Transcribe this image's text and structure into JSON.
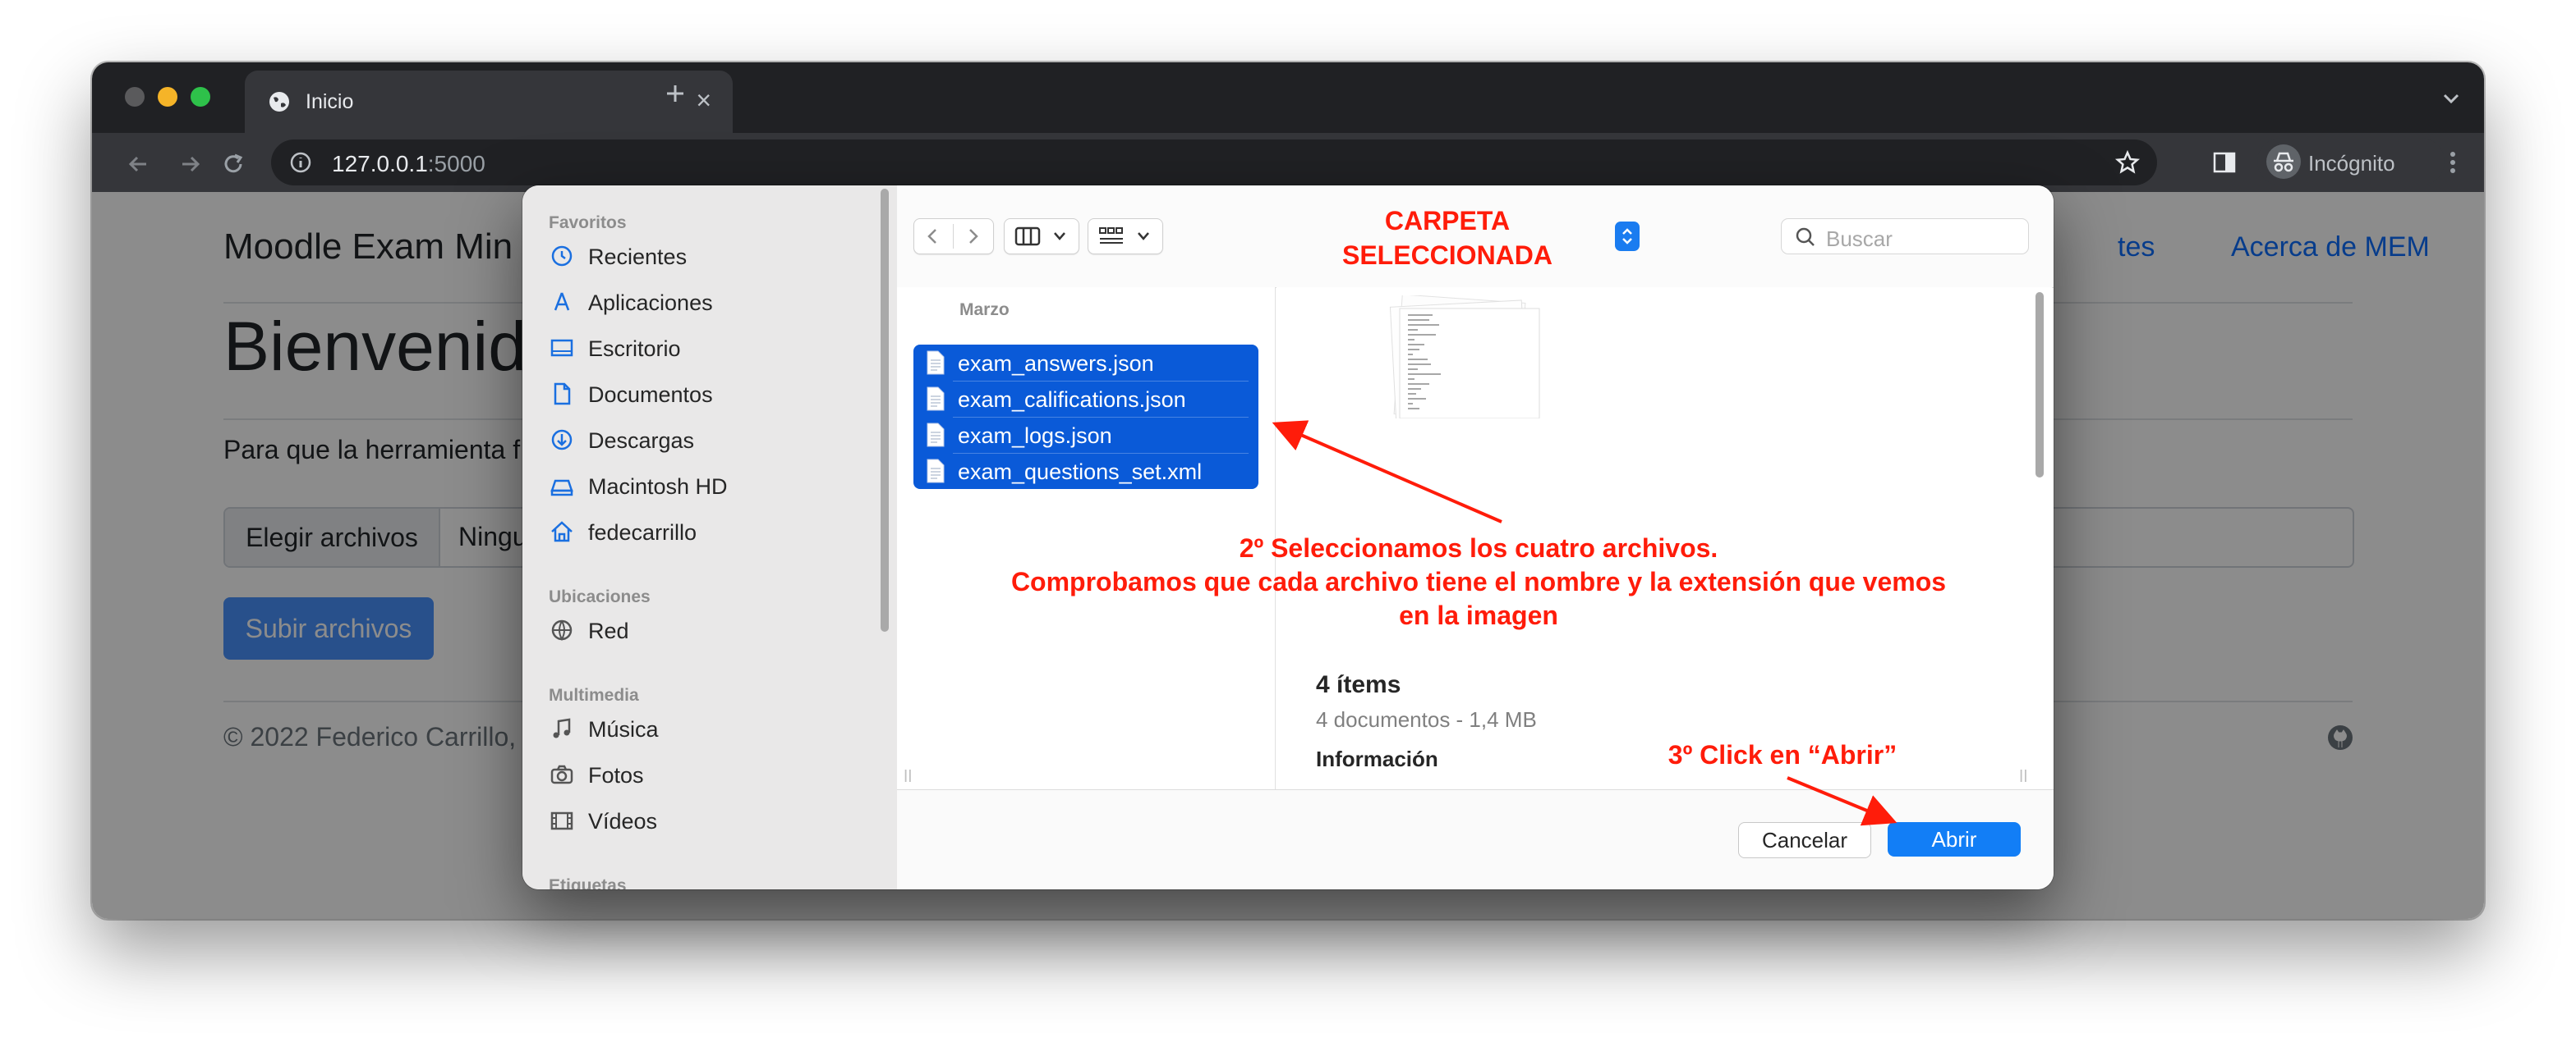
{
  "browser": {
    "tab_title": "Inicio",
    "url_host": "127.0.0.1",
    "url_port": ":5000",
    "profile_label": "Incógnito"
  },
  "page": {
    "brand": "Moodle Exam Min",
    "nav_links": [
      "tes",
      "Acerca de MEM"
    ],
    "heading": "Bienvenido",
    "lead": "Para que la herramienta f",
    "file_button": "Elegir archivos",
    "file_status": "Ningu",
    "upload_button": "Subir archivos",
    "footer": "© 2022 Federico Carrillo,"
  },
  "dialog": {
    "sidebar": {
      "sections": [
        {
          "title": "Favoritos",
          "items": [
            {
              "label": "Recientes",
              "icon": "clock-icon"
            },
            {
              "label": "Aplicaciones",
              "icon": "applications-icon"
            },
            {
              "label": "Escritorio",
              "icon": "desktop-icon"
            },
            {
              "label": "Documentos",
              "icon": "document-icon"
            },
            {
              "label": "Descargas",
              "icon": "download-icon"
            },
            {
              "label": "Macintosh HD",
              "icon": "hard-drive-icon"
            },
            {
              "label": "fedecarrillo",
              "icon": "home-icon"
            }
          ]
        },
        {
          "title": "Ubicaciones",
          "items": [
            {
              "label": "Red",
              "icon": "globe-icon"
            }
          ]
        },
        {
          "title": "Multimedia",
          "items": [
            {
              "label": "Música",
              "icon": "music-icon"
            },
            {
              "label": "Fotos",
              "icon": "camera-icon"
            },
            {
              "label": "Vídeos",
              "icon": "film-icon"
            }
          ]
        },
        {
          "title": "Etiquetas",
          "items": []
        }
      ]
    },
    "search_placeholder": "Buscar",
    "column_header": "Marzo",
    "files": [
      "exam_answers.json",
      "exam_califications.json",
      "exam_logs.json",
      "exam_questions_set.xml"
    ],
    "preview": {
      "items_title": "4 ítems",
      "items_subtitle": "4 documentos - 1,4 MB",
      "info_heading": "Información"
    },
    "cancel_button": "Cancelar",
    "open_button": "Abrir",
    "accent_color": "#127ef6",
    "selection_color": "#0a5ad8"
  },
  "annotations": {
    "folder_line1": "CARPETA",
    "folder_line2": "SELECCIONADA",
    "step2_line1": "2º Seleccionamos los cuatro archivos.",
    "step2_line2": "Comprobamos que cada archivo tiene el nombre y la extensión que vemos",
    "step2_line3": "en la imagen",
    "step3": "3º Click en “Abrir”",
    "color": "#ff1c0a"
  }
}
